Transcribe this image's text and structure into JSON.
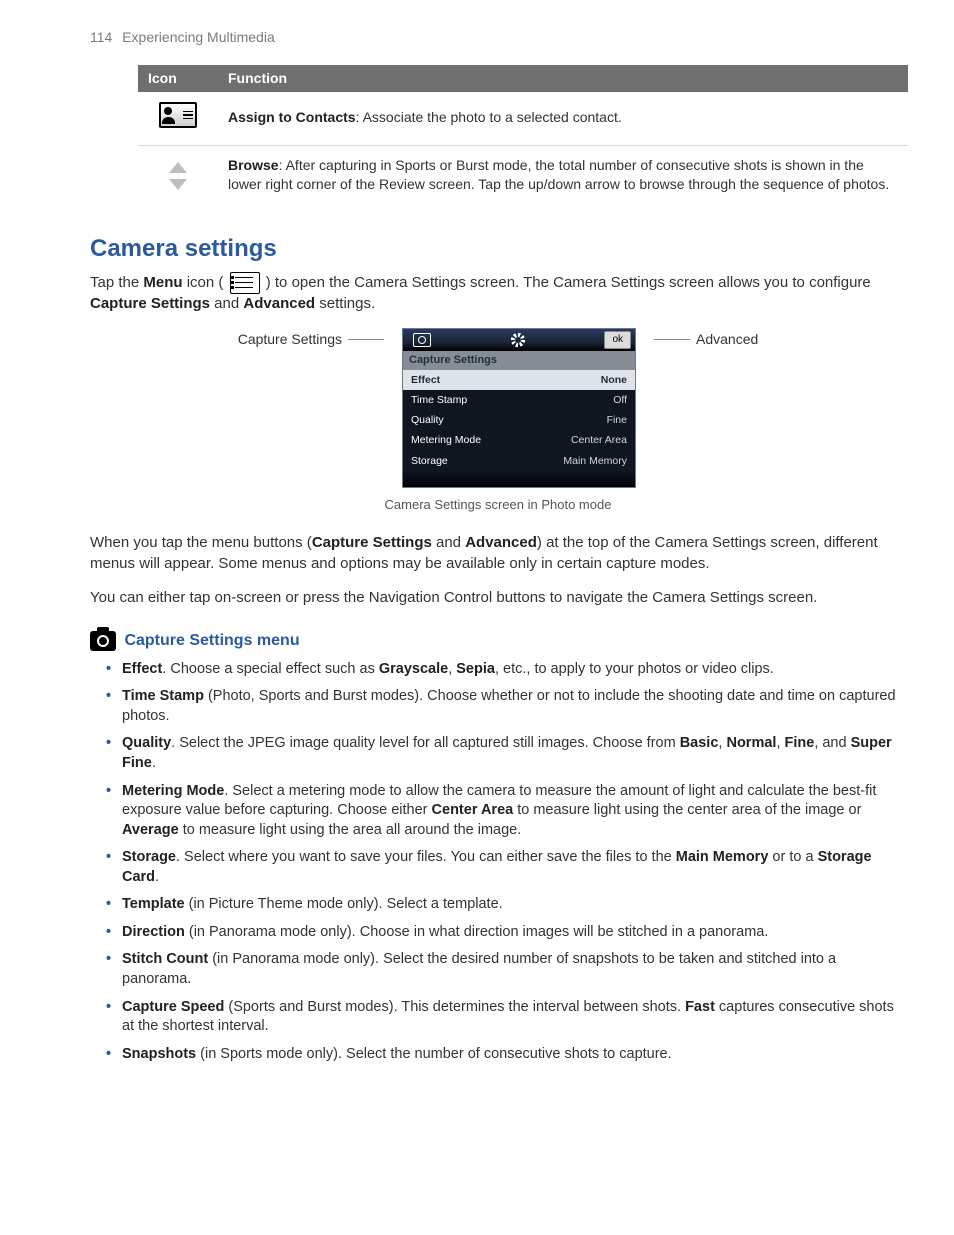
{
  "header": {
    "pageNumber": "114",
    "chapter": "Experiencing Multimedia"
  },
  "iconTable": {
    "head": {
      "c1": "Icon",
      "c2": "Function"
    },
    "rows": [
      {
        "iconName": "assign-contacts-icon",
        "title": "Assign to Contacts",
        "desc": ": Associate the photo to a selected contact."
      },
      {
        "iconName": "browse-arrows-icon",
        "title": "Browse",
        "desc": ": After capturing in Sports or Burst mode, the total number of consecutive shots is shown in the lower right corner of the Review screen. Tap the up/down arrow to browse through the sequence of photos."
      }
    ]
  },
  "section": {
    "title": "Camera settings",
    "intro1a": "Tap the ",
    "intro1b": "Menu",
    "intro1c": " icon ( ",
    "intro1d": " ) to open the Camera Settings screen. The Camera Settings screen allows you to configure ",
    "intro1e": "Capture Settings",
    "intro1f": " and ",
    "intro1g": "Advanced",
    "intro1h": " settings.",
    "figure": {
      "leftLabel": "Capture Settings",
      "rightLabel": "Advanced",
      "okLabel": "ok",
      "panelTitle": "Capture Settings",
      "rows": [
        {
          "k": "Effect",
          "v": "None"
        },
        {
          "k": "Time Stamp",
          "v": "Off"
        },
        {
          "k": "Quality",
          "v": "Fine"
        },
        {
          "k": "Metering Mode",
          "v": "Center Area"
        },
        {
          "k": "Storage",
          "v": "Main Memory"
        }
      ],
      "caption": "Camera Settings screen in Photo mode"
    },
    "p2a": "When you tap the menu buttons (",
    "p2b": "Capture Settings",
    "p2c": " and ",
    "p2d": "Advanced",
    "p2e": ") at the top of the Camera Settings screen, different menus will appear. Some menus and options may be available only in certain capture modes.",
    "p3": "You can either tap on-screen or press the Navigation Control buttons to navigate the Camera Settings screen."
  },
  "captureMenu": {
    "heading": "Capture Settings menu",
    "items": {
      "effect": {
        "t": "Effect",
        "a": ". Choose a special effect such as ",
        "b1": "Grayscale",
        "c": ", ",
        "b2": "Sepia",
        "d": ", etc., to apply to your photos or video clips."
      },
      "timestamp": {
        "t": "Time Stamp",
        "a": " (Photo, Sports and Burst modes). Choose whether or not to include the shooting date and time on captured photos."
      },
      "quality": {
        "t": "Quality",
        "a": ". Select the JPEG image quality level for all captured still images. Choose from ",
        "b1": "Basic",
        "c1": ", ",
        "b2": "Normal",
        "c2": ", ",
        "b3": "Fine",
        "c3": ", and ",
        "b4": "Super Fine",
        "c4": "."
      },
      "metering": {
        "t": "Metering Mode",
        "a": ". Select a metering mode to allow the camera to measure the amount of light and calculate the best-fit exposure value before capturing. Choose either ",
        "b1": "Center Area",
        "c": " to measure light using the center area of the image or ",
        "b2": "Average",
        "d": " to measure light using the area all around the image."
      },
      "storage": {
        "t": "Storage",
        "a": ". Select where you want to save your files. You can either save the files to the ",
        "b1": "Main Memory",
        "c": " or to a ",
        "b2": "Storage Card",
        "d": "."
      },
      "template": {
        "t": "Template",
        "a": " (in Picture Theme mode only). Select a template."
      },
      "direction": {
        "t": "Direction",
        "a": " (in Panorama mode only). Choose in what direction images will be stitched in a panorama."
      },
      "stitch": {
        "t": "Stitch Count",
        "a": " (in Panorama mode only). Select the desired number of snapshots to be taken and stitched into a panorama."
      },
      "speed": {
        "t": "Capture Speed",
        "a": " (Sports and Burst modes). This determines the interval between shots. ",
        "b1": "Fast",
        "c": " captures consecutive shots at the shortest interval."
      },
      "snapshots": {
        "t": "Snapshots",
        "a": " (in Sports mode only). Select the number of consecutive shots to capture."
      }
    }
  }
}
